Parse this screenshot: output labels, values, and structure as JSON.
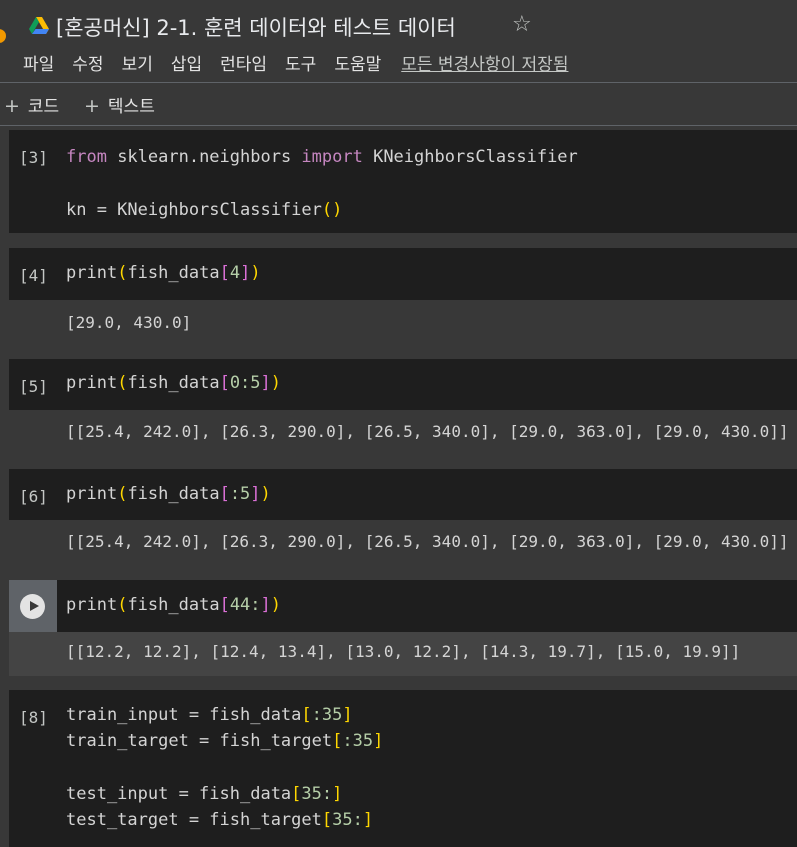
{
  "header": {
    "title": "[혼공머신] 2-1. 훈련 데이터와 테스트 데이터",
    "star": "☆",
    "menu": [
      "파일",
      "수정",
      "보기",
      "삽입",
      "런타임",
      "도구",
      "도움말"
    ],
    "saved_status": "모든 변경사항이 저장됨"
  },
  "toolbar": {
    "add_code_label": "코드",
    "add_text_label": "텍스트",
    "plus": "+"
  },
  "cells": {
    "c3": {
      "count": "[3]",
      "line1_kw1": "from",
      "line1_mod": " sklearn.neighbors ",
      "line1_kw2": "import",
      "line1_name": " KNeighborsClassifier",
      "line2_a": "kn = KNeighborsClassifier",
      "line2_paren": "()"
    },
    "c4": {
      "count": "[4]",
      "fn": "print",
      "p_open": "(",
      "arg": "fish_data",
      "b_open": "[",
      "idx": "4",
      "b_close": "]",
      "p_close": ")",
      "output": "[29.0, 430.0]"
    },
    "c5": {
      "count": "[5]",
      "fn": "print",
      "p_open": "(",
      "arg": "fish_data",
      "b_open": "[",
      "idx": "0:5",
      "b_close": "]",
      "p_close": ")",
      "output": "[[25.4, 242.0], [26.3, 290.0], [26.5, 340.0], [29.0, 363.0], [29.0, 430.0]]"
    },
    "c6": {
      "count": "[6]",
      "fn": "print",
      "p_open": "(",
      "arg": "fish_data",
      "b_open": "[",
      "idx": ":5",
      "b_close": "]",
      "p_close": ")",
      "output": "[[25.4, 242.0], [26.3, 290.0], [26.5, 340.0], [29.0, 363.0], [29.0, 430.0]]"
    },
    "c7": {
      "fn": "print",
      "p_open": "(",
      "arg": "fish_data",
      "b_open": "[",
      "idx": "44:",
      "b_close": "]",
      "p_close": ")",
      "output": "[[12.2, 12.2], [12.4, 13.4], [13.0, 12.2], [14.3, 19.7], [15.0, 19.9]]"
    },
    "c8": {
      "count": "[8]",
      "l1_a": "train_input = fish_data",
      "l1_b": "[",
      "l1_c": ":35",
      "l1_d": "]",
      "l2_a": "train_target = fish_target",
      "l2_b": "[",
      "l2_c": ":35",
      "l2_d": "]",
      "l3_a": "test_input = fish_data",
      "l3_b": "[",
      "l3_c": "35:",
      "l3_d": "]",
      "l4_a": "test_target = fish_target",
      "l4_b": "[",
      "l4_c": "35:",
      "l4_d": "]"
    }
  }
}
